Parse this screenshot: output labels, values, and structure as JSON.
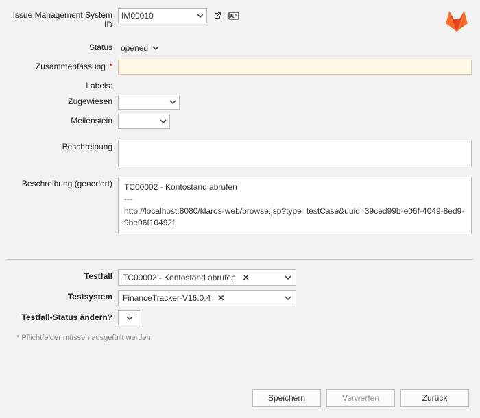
{
  "logo": {
    "name": "gitlab-logo"
  },
  "fields": {
    "ims": {
      "label": "Issue Management System ID",
      "value": "IM00010"
    },
    "status": {
      "label": "Status",
      "value": "opened"
    },
    "summary": {
      "label": "Zusammenfassung",
      "required_marker": "*",
      "value": ""
    },
    "labels": {
      "label": "Labels:"
    },
    "assignee": {
      "label": "Zugewiesen",
      "value": ""
    },
    "milestone": {
      "label": "Meilenstein",
      "value": ""
    },
    "description": {
      "label": "Beschreibung",
      "value": ""
    },
    "description_generated": {
      "label": "Beschreibung (generiert)",
      "line1": "TC00002 - Kontostand abrufen",
      "line2": "---",
      "line3": "http://localhost:8080/klaros-web/browse.jsp?type=testCase&uuid=39ced99b-e06f-4049-8ed9-9be06f10492f"
    },
    "testcase": {
      "label": "Testfall",
      "value": "TC00002 - Kontostand abrufen"
    },
    "testsystem": {
      "label": "Testsystem",
      "value": "FinanceTracker-V16.0.4"
    },
    "testcase_status_change": {
      "label": "Testfall-Status ändern?",
      "value": ""
    }
  },
  "footnote": "* Pflichtfelder müssen ausgefüllt werden",
  "buttons": {
    "save": "Speichern",
    "discard": "Verwerfen",
    "back": "Zurück"
  }
}
